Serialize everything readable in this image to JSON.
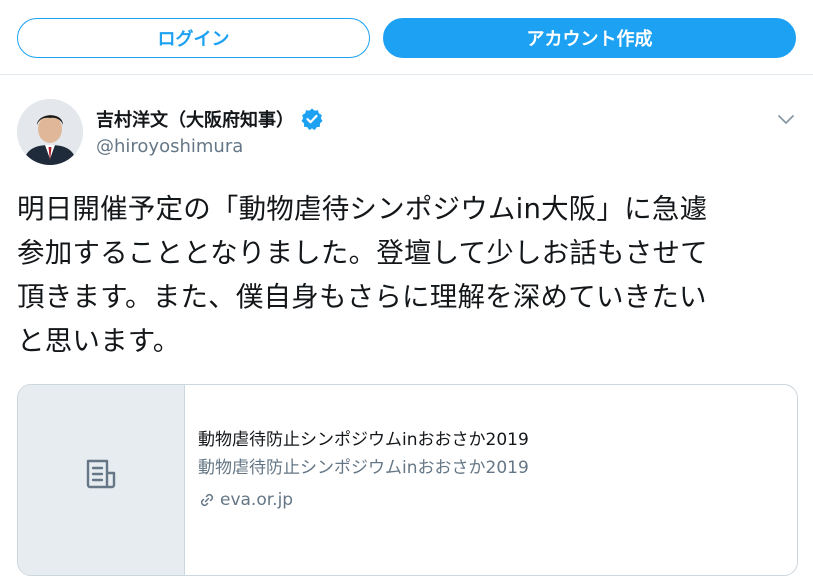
{
  "header": {
    "login_label": "ログイン",
    "signup_label": "アカウント作成"
  },
  "tweet": {
    "author_name": "吉村洋文（大阪府知事）",
    "handle": "@hiroyoshimura",
    "verified": true,
    "text_lines": [
      "明日開催予定の「動物虐待シンポジウムin大阪」に急遽",
      "参加することとなりました。登壇して少しお話もさせて",
      "頂きます。また、僕自身もさらに理解を深めていきたい",
      "と思います。"
    ]
  },
  "card": {
    "title": "動物虐待防止シンポジウムinおおさか2019",
    "description": "動物虐待防止シンポジウムinおおさか2019",
    "domain": "eva.or.jp",
    "thumb_icon": "document-icon"
  },
  "colors": {
    "accent": "#1da1f2",
    "secondary_text": "#657786",
    "border": "#ccd6dd"
  }
}
